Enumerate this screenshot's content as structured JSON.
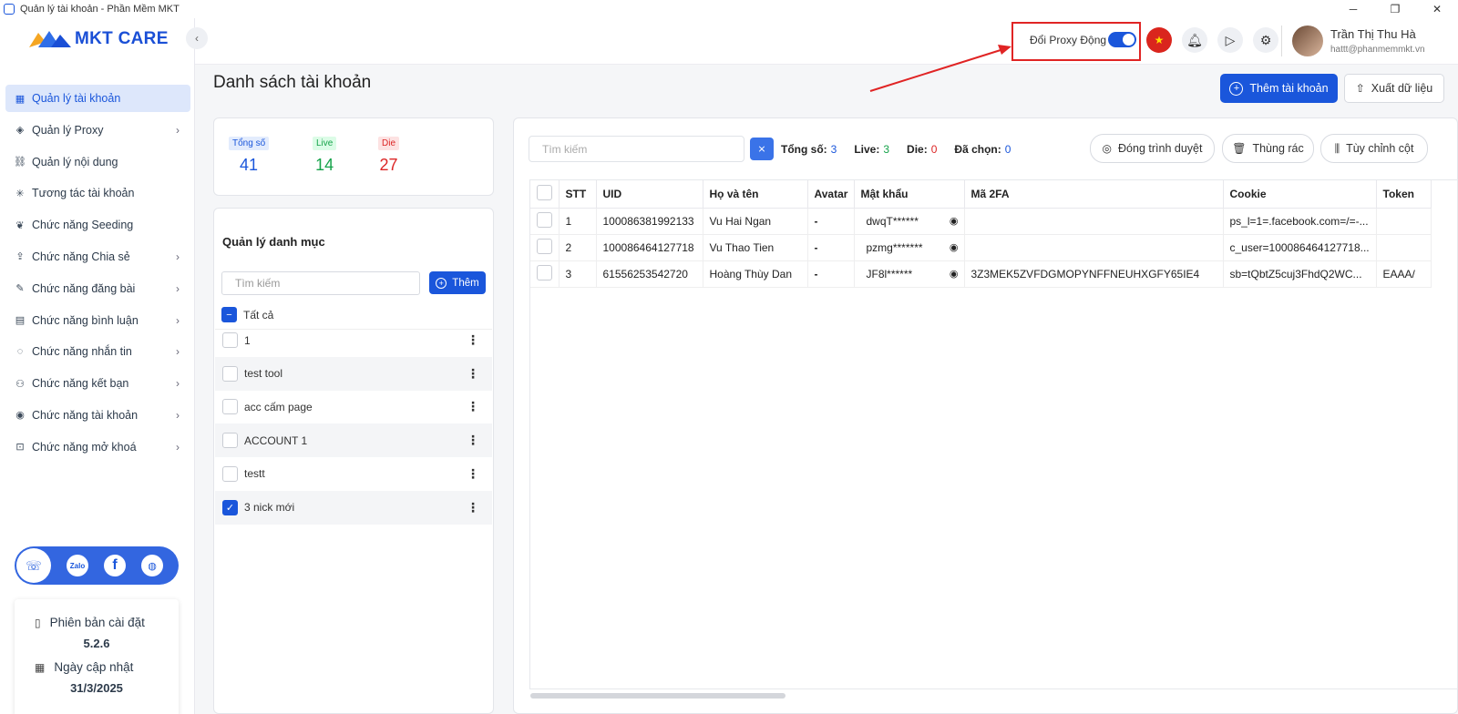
{
  "window": {
    "title": "Quản lý tài khoản - Phần Mềm MKT"
  },
  "brand": {
    "logo_text": "MKT CARE"
  },
  "sidebar": {
    "items": [
      {
        "label": "Quản lý tài khoản",
        "icon": "grid-icon",
        "active": true,
        "chevron": false
      },
      {
        "label": "Quản lý Proxy",
        "icon": "layers-icon",
        "chevron": true
      },
      {
        "label": "Quản lý nội dung",
        "icon": "link-icon",
        "chevron": false
      },
      {
        "label": "Tương tác tài khoản",
        "icon": "sparkle-icon",
        "chevron": false
      },
      {
        "label": "Chức năng Seeding",
        "icon": "seed-icon",
        "chevron": false
      },
      {
        "label": "Chức năng Chia sẻ",
        "icon": "share-icon",
        "chevron": true
      },
      {
        "label": "Chức năng đăng bài",
        "icon": "post-icon",
        "chevron": true
      },
      {
        "label": "Chức năng bình luận",
        "icon": "comment-icon",
        "chevron": true
      },
      {
        "label": "Chức năng nhắn tin",
        "icon": "message-icon",
        "chevron": true
      },
      {
        "label": "Chức năng kết bạn",
        "icon": "add-friend-icon",
        "chevron": true
      },
      {
        "label": "Chức năng tài khoản",
        "icon": "account-icon",
        "chevron": true
      },
      {
        "label": "Chức năng mở khoá",
        "icon": "unlock-icon",
        "chevron": true
      }
    ],
    "version_label": "Phiên bản cài đặt",
    "version_value": "5.2.6",
    "update_label": "Ngày cập nhật",
    "update_value": "31/3/2025",
    "social": {
      "zalo": "Zalo",
      "facebook": "f"
    }
  },
  "header": {
    "proxy_label": "Đổi Proxy Động",
    "proxy_on": true,
    "user_name": "Trần Thị Thu Hà",
    "user_email": "hattt@phanmemmkt.vn"
  },
  "main": {
    "title": "Danh sách tài khoản",
    "add_account": "Thêm tài khoản",
    "export": "Xuất dữ liệu",
    "stats": {
      "total_label": "Tổng số",
      "total": "41",
      "live_label": "Live",
      "live": "14",
      "die_label": "Die",
      "die": "27"
    },
    "categories": {
      "title": "Quản lý danh mục",
      "search_placeholder": "Tìm kiếm",
      "add_label": "Thêm",
      "all_label": "Tất cả",
      "items": [
        {
          "name": "1",
          "checked": false
        },
        {
          "name": "test tool",
          "checked": false
        },
        {
          "name": "acc cấm page",
          "checked": false
        },
        {
          "name": "ACCOUNT 1",
          "checked": false
        },
        {
          "name": "testt",
          "checked": false
        },
        {
          "name": "3 nick mới",
          "checked": true
        }
      ]
    },
    "toolbar": {
      "search_placeholder": "Tìm kiếm",
      "total_label": "Tổng số:",
      "total": "3",
      "live_label": "Live:",
      "live": "3",
      "die_label": "Die:",
      "die": "0",
      "selected_label": "Đã chọn:",
      "selected": "0",
      "close_browser": "Đóng trình duyệt",
      "trash": "Thùng rác",
      "customize_columns": "Tùy chỉnh cột"
    },
    "table": {
      "columns": [
        "STT",
        "UID",
        "Họ và tên",
        "Avatar",
        "Mật khẩu",
        "Mã 2FA",
        "Cookie",
        "Token"
      ],
      "rows": [
        {
          "stt": "1",
          "uid": "100086381992133",
          "name": "Vu Hai Ngan",
          "avatar": "-",
          "password": "dwqT******",
          "twofa": "",
          "cookie": "ps_l=1=.facebook.com=/=-...",
          "token": ""
        },
        {
          "stt": "2",
          "uid": "100086464127718",
          "name": "Vu Thao Tien",
          "avatar": "-",
          "password": "pzmg*******",
          "twofa": "",
          "cookie": "c_user=100086464127718...",
          "token": ""
        },
        {
          "stt": "3",
          "uid": "61556253542720",
          "name": "Hoàng Thùy Dan",
          "avatar": "-",
          "password": "JF8l******",
          "twofa": "3Z3MEK5ZVFDGMOPYNFFNEUHXGFY65IE4",
          "cookie": "sb=tQbtZ5cuj3FhdQ2WC...",
          "token": "EAAA/"
        }
      ]
    }
  },
  "colors": {
    "accent": "#1a56db",
    "live": "#16a34a",
    "die": "#dc2626",
    "highlight": "#e02424"
  }
}
